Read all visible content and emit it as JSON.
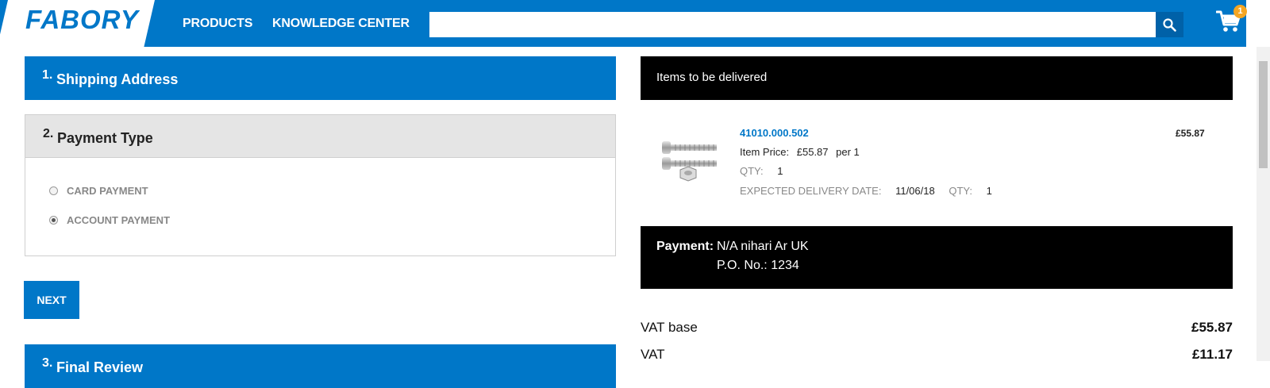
{
  "brand": {
    "logo": "FABORY",
    "primary_color": "#0077c8",
    "accent_color": "#f5a623"
  },
  "nav": {
    "products": "PRODUCTS",
    "knowledge_center": "KNOWLEDGE CENTER"
  },
  "search": {
    "placeholder": "",
    "icon": "search-icon"
  },
  "cart": {
    "icon": "cart-icon",
    "count": "1"
  },
  "checkout": {
    "steps": [
      {
        "number": "1.",
        "title": "Shipping Address",
        "state": "completed"
      },
      {
        "number": "2.",
        "title": "Payment Type",
        "state": "active"
      },
      {
        "number": "3.",
        "title": "Final Review",
        "state": "upcoming"
      }
    ],
    "payment_options": [
      {
        "label": "CARD PAYMENT",
        "selected": false
      },
      {
        "label": "ACCOUNT PAYMENT",
        "selected": true
      }
    ],
    "next_label": "NEXT"
  },
  "order_summary": {
    "items_title": "Items to be delivered",
    "item": {
      "sku": "41010.000.502",
      "price_total": "£55.87",
      "item_price_label": "Item Price:",
      "item_price_value": "£55.87",
      "item_price_unit": "per 1",
      "qty_label": "QTY:",
      "qty_value": "1",
      "delivery_label": "EXPECTED DELIVERY DATE:",
      "delivery_date": "11/06/18",
      "delivery_qty_label": "QTY:",
      "delivery_qty_value": "1"
    },
    "payment": {
      "label": "Payment:",
      "value": "N/A nihari Ar UK",
      "po_label": "P.O. No.:",
      "po_value": "1234"
    },
    "totals": [
      {
        "label": "VAT base",
        "value": "£55.87"
      },
      {
        "label": "VAT",
        "value": "£11.17"
      }
    ]
  }
}
